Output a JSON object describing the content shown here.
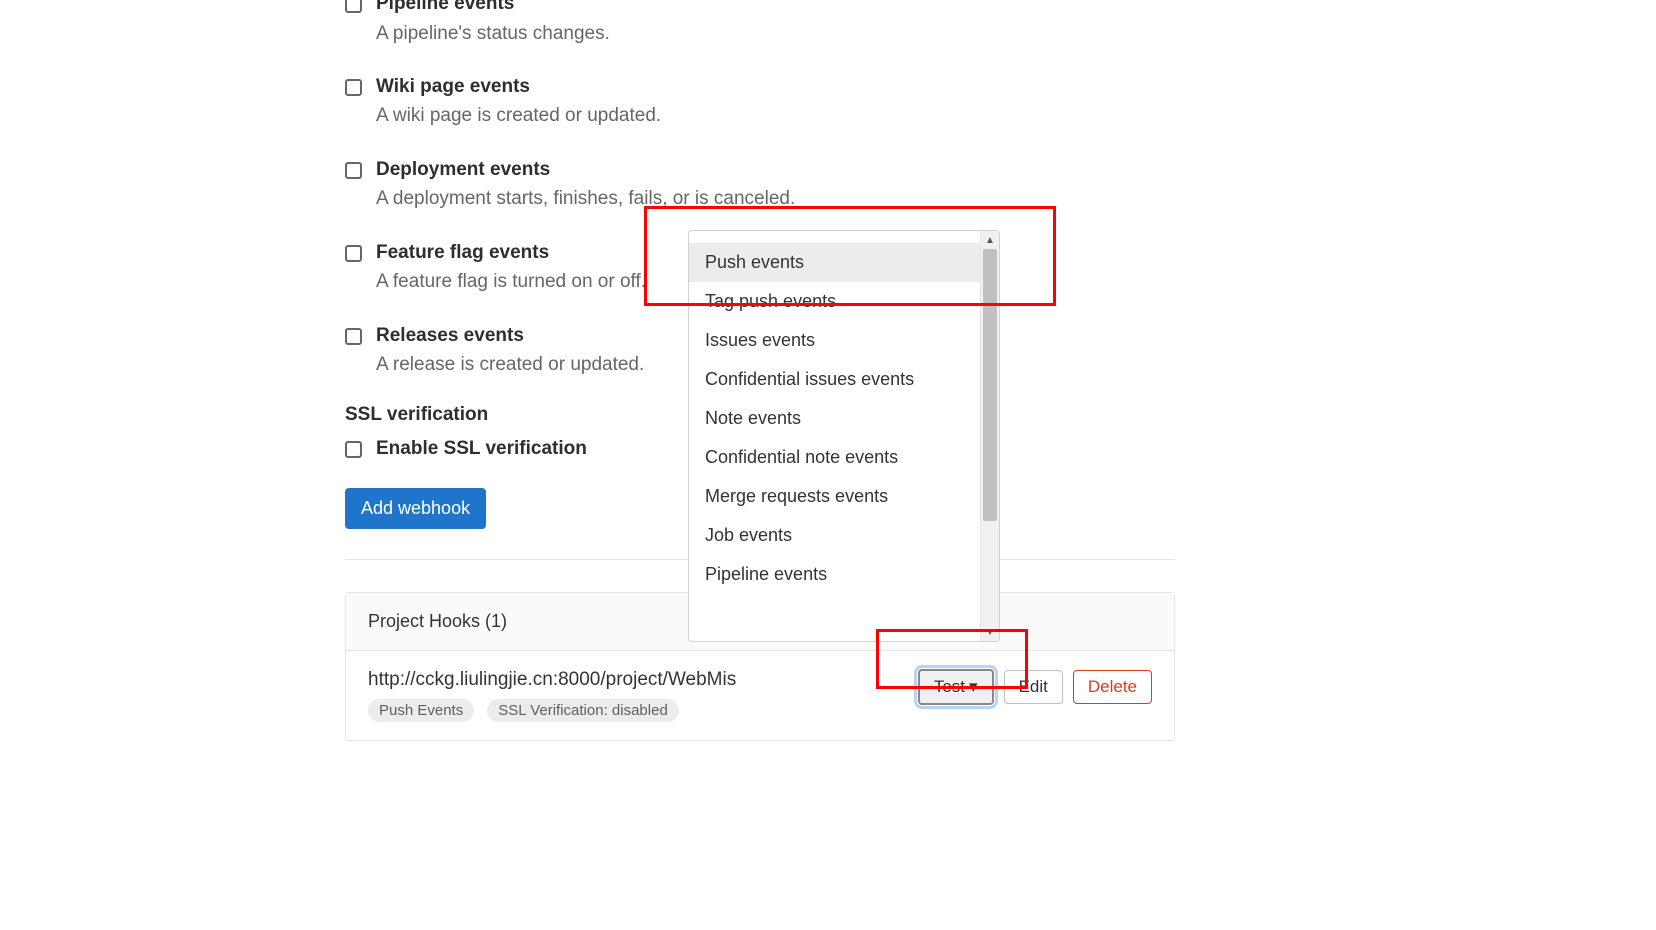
{
  "triggers": [
    {
      "title": "Pipeline events",
      "desc": "A pipeline's status changes."
    },
    {
      "title": "Wiki page events",
      "desc": "A wiki page is created or updated."
    },
    {
      "title": "Deployment events",
      "desc": "A deployment starts, finishes, fails, or is canceled."
    },
    {
      "title": "Feature flag events",
      "desc": "A feature flag is turned on or off."
    },
    {
      "title": "Releases events",
      "desc": "A release is created or updated."
    }
  ],
  "ssl": {
    "heading": "SSL verification",
    "checkbox_label": "Enable SSL verification"
  },
  "add_button": "Add webhook",
  "hooks": {
    "header": "Project Hooks (1)",
    "url": "http://cckg.liulingjie.cn:8000/project/WebMis",
    "badges": [
      "Push Events",
      "SSL Verification: disabled"
    ],
    "test_label": "Test",
    "edit_label": "Edit",
    "delete_label": "Delete"
  },
  "dropdown": {
    "items": [
      "Push events",
      "Tag push events",
      "Issues events",
      "Confidential issues events",
      "Note events",
      "Confidential note events",
      "Merge requests events",
      "Job events",
      "Pipeline events"
    ],
    "highlighted_index": 0
  }
}
